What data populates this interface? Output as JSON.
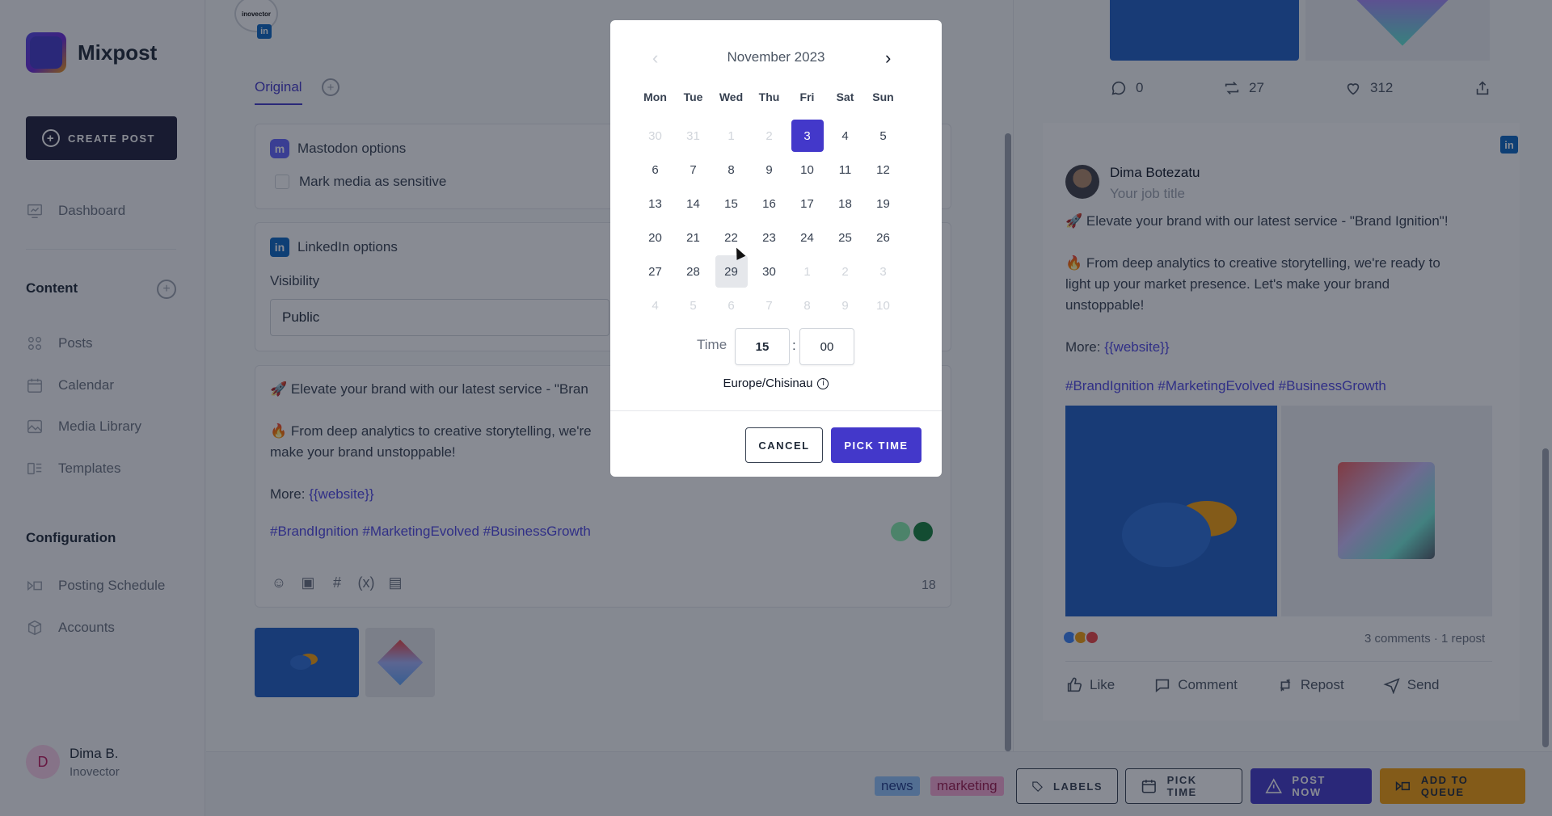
{
  "app": {
    "name": "Mixpost",
    "create_post": "CREATE POST"
  },
  "sidebar": {
    "dashboard": "Dashboard",
    "content_title": "Content",
    "content_items": [
      "Posts",
      "Calendar",
      "Media Library",
      "Templates"
    ],
    "config_title": "Configuration",
    "config_items": [
      "Posting Schedule",
      "Accounts"
    ],
    "user": {
      "initial": "D",
      "name": "Dima B.",
      "org": "Inovector"
    }
  },
  "editor": {
    "account_avatar_text": "inovector",
    "tab_original": "Original",
    "mastodon_title": "Mastodon options",
    "mark_sensitive": "Mark media as sensitive",
    "linkedin_title": "LinkedIn options",
    "visibility_label": "Visibility",
    "visibility_value": "Public",
    "body_line1": "🚀 Elevate your brand with our latest service - \"Bran",
    "body_line2": "🔥 From deep analytics to creative storytelling, we're",
    "body_line3": "make your brand unstoppable!",
    "more_label": "More: ",
    "more_link": "{{website}}",
    "hashtags": "#BrandIgnition #MarketingEvolved #BusinessGrowth",
    "char_count": "18"
  },
  "preview": {
    "stats": {
      "replies": "0",
      "reposts": "27",
      "likes": "312"
    },
    "profile_name": "Dima Botezatu",
    "profile_title": "Your job title",
    "line1": "🚀 Elevate your brand with our latest service - \"Brand Ignition\"!",
    "line2": "🔥 From deep analytics to creative storytelling, we're ready to",
    "line3": "light up your market presence. Let's make your brand",
    "line4": "unstoppable!",
    "more_label": "More: ",
    "more_link": "{{website}}",
    "hashtags": "#BrandIgnition #MarketingEvolved #BusinessGrowth",
    "reaction_summary": "3 comments · 1 repost",
    "actions": {
      "like": "Like",
      "comment": "Comment",
      "repost": "Repost",
      "send": "Send"
    }
  },
  "bottombar": {
    "labels": [
      "news",
      "marketing"
    ],
    "labels_button": "LABELS",
    "pick_time_button": "PICK TIME",
    "post_now_button": "POST NOW",
    "add_to_queue_button": "ADD TO QUEUE"
  },
  "datepicker": {
    "month_label": "November 2023",
    "weekdays": [
      "Mon",
      "Tue",
      "Wed",
      "Thu",
      "Fri",
      "Sat",
      "Sun"
    ],
    "weeks": [
      [
        "30",
        "31",
        "1",
        "2",
        "3",
        "4",
        "5"
      ],
      [
        "6",
        "7",
        "8",
        "9",
        "10",
        "11",
        "12"
      ],
      [
        "13",
        "14",
        "15",
        "16",
        "17",
        "18",
        "19"
      ],
      [
        "20",
        "21",
        "22",
        "23",
        "24",
        "25",
        "26"
      ],
      [
        "27",
        "28",
        "29",
        "30",
        "1",
        "2",
        "3"
      ],
      [
        "4",
        "5",
        "6",
        "7",
        "8",
        "9",
        "10"
      ]
    ],
    "selected_day": "3",
    "hovered_day": "29",
    "time_label": "Time",
    "hour": "15",
    "minute": "00",
    "timezone": "Europe/Chisinau",
    "cancel": "CANCEL",
    "pick_time": "PICK TIME"
  },
  "colors": {
    "primary": "#4338ca",
    "accent": "#f59e0b",
    "linkedin": "#0a66c2",
    "mastodon": "#6364ff"
  }
}
